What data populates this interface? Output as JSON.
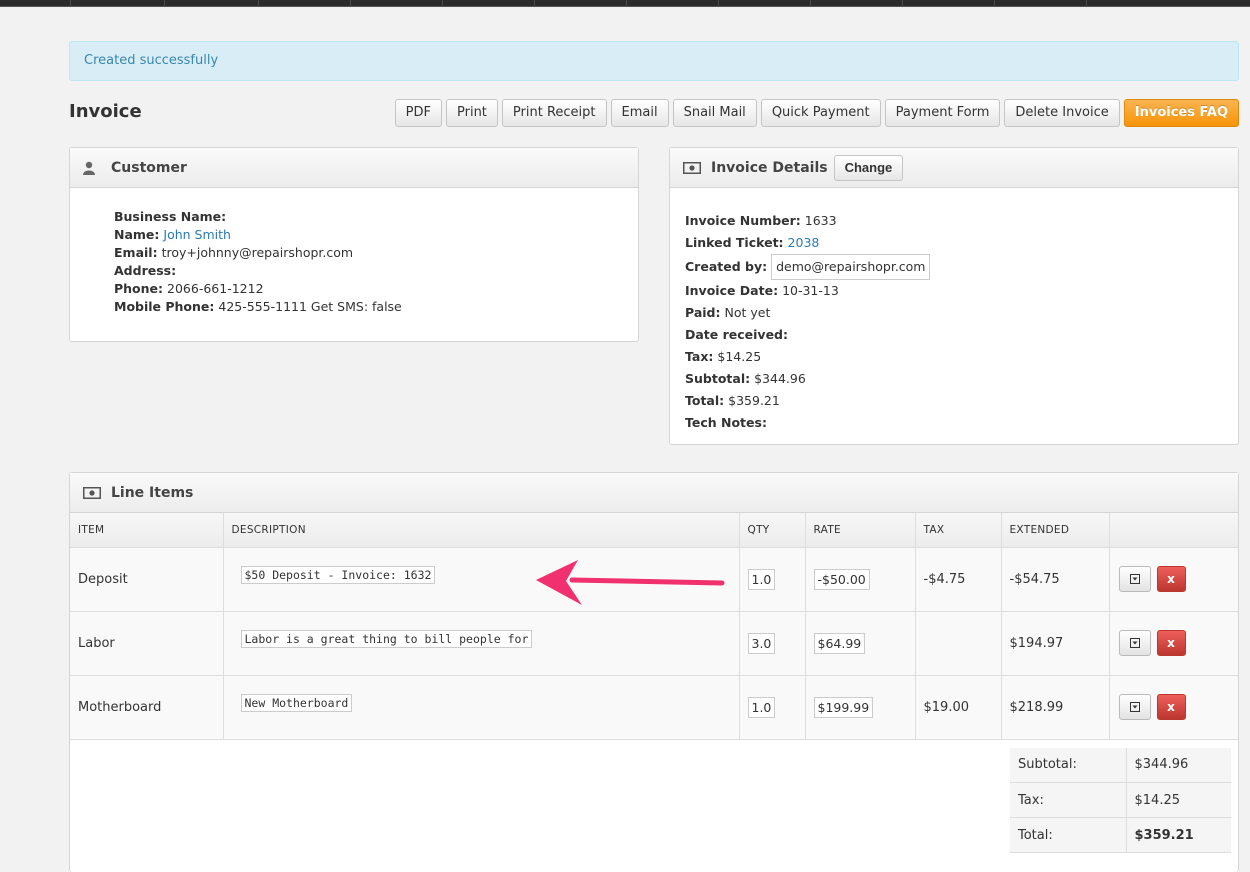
{
  "alert": {
    "message": "Created successfully"
  },
  "page": {
    "title": "Invoice"
  },
  "toolbar": {
    "pdf": "PDF",
    "print": "Print",
    "print_receipt": "Print Receipt",
    "email": "Email",
    "snail_mail": "Snail Mail",
    "quick_payment": "Quick Payment",
    "payment_form": "Payment Form",
    "delete_invoice": "Delete Invoice",
    "invoices_faq": "Invoices FAQ"
  },
  "customer": {
    "title": "Customer",
    "business_name_label": "Business Name:",
    "name_label": "Name:",
    "name_value": "John Smith",
    "email_label": "Email:",
    "email_value": "troy+johnny@repairshopr.com",
    "address_label": "Address:",
    "phone_label": "Phone:",
    "phone_value": "2066-661-1212",
    "mobile_label": "Mobile Phone:",
    "mobile_value": "425-555-1111 Get SMS: false"
  },
  "invoice_details": {
    "title": "Invoice Details",
    "change_label": "Change",
    "invoice_number_label": "Invoice Number:",
    "invoice_number_value": "1633",
    "linked_ticket_label": "Linked Ticket:",
    "linked_ticket_value": "2038",
    "created_by_label": "Created by:",
    "created_by_value": "demo@repairshopr.com",
    "invoice_date_label": "Invoice Date:",
    "invoice_date_value": "10-31-13",
    "paid_label": "Paid:",
    "paid_value": "Not yet",
    "date_received_label": "Date received:",
    "tax_label": "Tax:",
    "tax_value": "$14.25",
    "subtotal_label": "Subtotal:",
    "subtotal_value": "$344.96",
    "total_label": "Total:",
    "total_value": "$359.21",
    "tech_notes_label": "Tech Notes:"
  },
  "line_items": {
    "title": "Line Items",
    "columns": [
      "ITEM",
      "DESCRIPTION",
      "QTY",
      "RATE",
      "TAX",
      "EXTENDED",
      ""
    ],
    "rows": [
      {
        "item": "Deposit",
        "description": "$50 Deposit - Invoice: 1632",
        "qty": "1.0",
        "rate": "-$50.00",
        "tax": "-$4.75",
        "extended": "-$54.75"
      },
      {
        "item": "Labor",
        "description": "Labor is a great thing to bill people for",
        "qty": "3.0",
        "rate": "$64.99",
        "tax": "",
        "extended": "$194.97"
      },
      {
        "item": "Motherboard",
        "description": "New Motherboard",
        "qty": "1.0",
        "rate": "$199.99",
        "tax": "$19.00",
        "extended": "$218.99"
      }
    ],
    "remove_label": "x",
    "totals": {
      "subtotal_label": "Subtotal:",
      "subtotal_value": "$344.96",
      "tax_label": "Tax:",
      "tax_value": "$14.25",
      "total_label": "Total:",
      "total_value": "$359.21"
    }
  },
  "colors": {
    "accent_orange": "#f89406",
    "alert_bg": "#d9edf7",
    "link": "#2a7ab8",
    "danger": "#bd362f",
    "arrow": "#f0306f"
  }
}
